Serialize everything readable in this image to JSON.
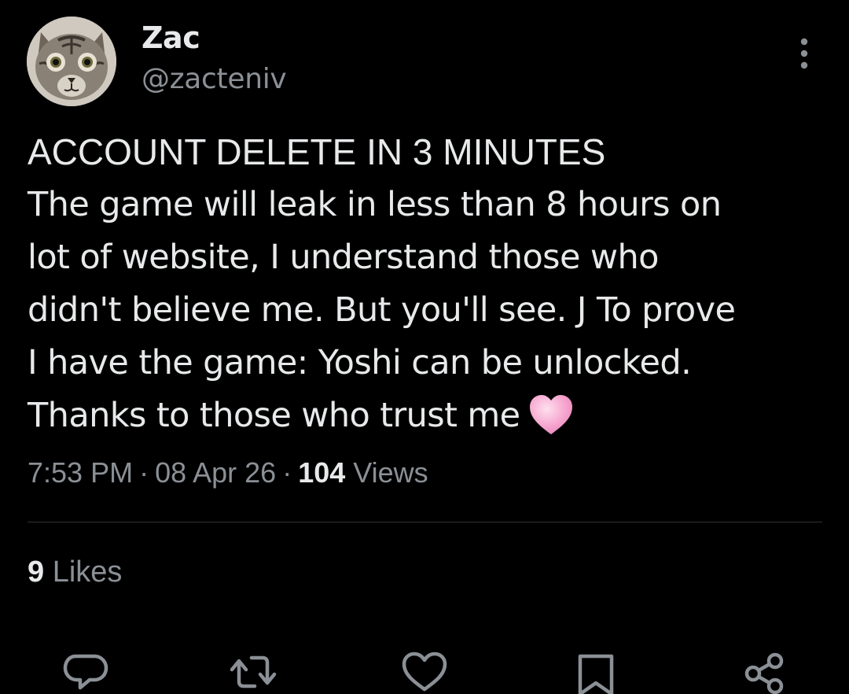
{
  "author": {
    "display_name": "Zac",
    "handle": "@zacteniv",
    "avatar": "cat-avatar"
  },
  "tweet": {
    "lines": [
      "ACCOUNT DELETE IN 3 MINUTES",
      "The game will leak in less than 8 hours on",
      "lot of website, I understand those who",
      "didn't believe me. But you'll see. J To prove",
      "I have the game: Yoshi can be unlocked.",
      "Thanks to those who trust me"
    ],
    "emoji": "pink-heart-emoji"
  },
  "meta": {
    "time": "7:53 PM",
    "separator": "·",
    "date": "08 Apr 26",
    "views_count": "104",
    "views_label": "Views"
  },
  "engagement": {
    "likes_count": "9",
    "likes_label": "Likes"
  },
  "actions": {
    "reply": "reply-icon",
    "retweet": "retweet-icon",
    "like": "heart-icon",
    "bookmark": "bookmark-icon",
    "share": "share-icon",
    "more": "more-options-icon"
  },
  "colors": {
    "background": "#000000",
    "text_primary": "#e7e9ea",
    "text_secondary": "#8b9096",
    "divider": "#2f3336",
    "icon": "#8b9096",
    "heart_emoji": "#f7a8d0"
  }
}
